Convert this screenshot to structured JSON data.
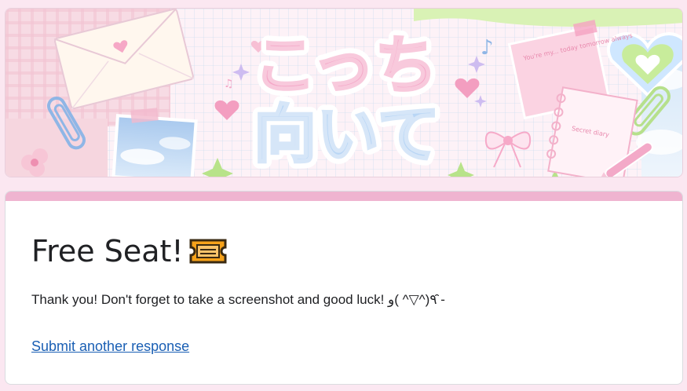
{
  "banner": {
    "title_line1": "こっち",
    "title_line2": "向いて",
    "note_text": "You're my... today tomorrow always",
    "notebook_text": "Secret diary"
  },
  "confirmation": {
    "title": "Free Seat!",
    "title_icon": "ticket-icon",
    "message": "Thank you! Don't forget to take a screenshot and good luck! ٩(^▽^ )و ̑̑-",
    "link_label": "Submit another response"
  },
  "colors": {
    "page_background": "#fbe7f1",
    "accent_bar": "#efb4d0",
    "link": "#1a5fb4",
    "text": "#202124"
  }
}
